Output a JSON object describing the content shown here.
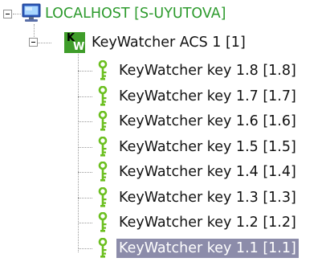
{
  "tree": {
    "root": {
      "label": "LOCALHOST [S-UYUTOVA]",
      "icon": "computer-icon",
      "expanded": true
    },
    "cabinet": {
      "label": "KeyWatcher ACS 1 [1]",
      "icon": "keywatcher-icon",
      "icon_text_k": "K",
      "icon_text_w": "W",
      "expanded": true
    },
    "keys": [
      {
        "label": "KeyWatcher key 1.8 [1.8]",
        "selected": false
      },
      {
        "label": "KeyWatcher key 1.7 [1.7]",
        "selected": false
      },
      {
        "label": "KeyWatcher key 1.6 [1.6]",
        "selected": false
      },
      {
        "label": "KeyWatcher key 1.5 [1.5]",
        "selected": false
      },
      {
        "label": "KeyWatcher key 1.4 [1.4]",
        "selected": false
      },
      {
        "label": "KeyWatcher key 1.3 [1.3]",
        "selected": false
      },
      {
        "label": "KeyWatcher key 1.2 [1.2]",
        "selected": false
      },
      {
        "label": "KeyWatcher key 1.1 [1.1]",
        "selected": true
      }
    ]
  },
  "colors": {
    "host_text": "#2c9a2c",
    "selection_bg": "#8c8caa",
    "key_icon": "#6bbf1f"
  }
}
